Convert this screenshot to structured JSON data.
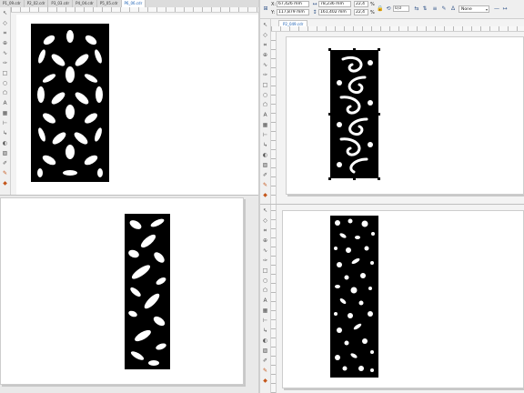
{
  "top_left": {
    "tabs": [
      "P1_09.cdr",
      "P2_02.cdr",
      "P3_03.cdr",
      "P4_04.cdr",
      "P5_05.cdr",
      "P6_06.cdr"
    ],
    "active_tab": 5
  },
  "top_right": {
    "x_label": "X:",
    "y_label": "Y:",
    "x_value": "67,426 mm",
    "y_value": "117,879 mm",
    "w_value": "78,236 mm",
    "h_value": "161,402 mm",
    "scale_w": "22,4",
    "scale_h": "22,4",
    "percent": "%",
    "rotation": "0,0",
    "outline_label": "None",
    "document_tab": "P2_049.cdr"
  },
  "toolbox_icons": [
    "pick-icon",
    "shape-icon",
    "crop-icon",
    "zoom-icon",
    "freehand-icon",
    "artistic-media-icon",
    "rectangle-icon",
    "ellipse-icon",
    "polygon-icon",
    "text-icon",
    "table-icon",
    "dimension-icon",
    "connector-icon",
    "blend-icon",
    "transparency-icon",
    "eyedropper-icon",
    "outline-icon",
    "fill-icon",
    "interactive-fill-icon",
    "plus-icon"
  ],
  "colors": {
    "pattern": "#000000",
    "selection_handle": "#000000",
    "accent_tool": "#c4561b",
    "active_tab_text": "#1a5fb4"
  }
}
